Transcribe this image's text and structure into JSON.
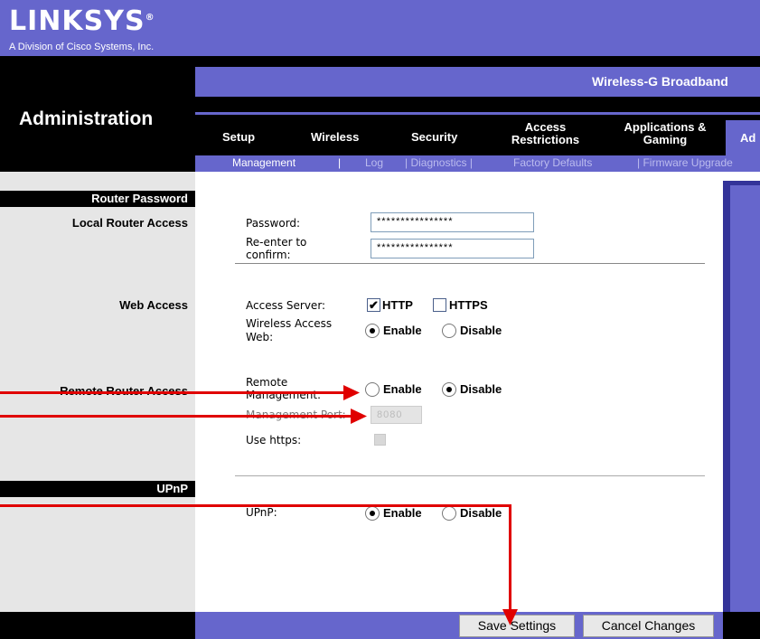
{
  "brand": {
    "logo": "LINKSYS",
    "registered": "®",
    "tagline": "A Division of Cisco Systems, Inc."
  },
  "product_title": "Wireless-G Broadband",
  "page_title": "Administration",
  "tabs": [
    {
      "label": "Setup"
    },
    {
      "label": "Wireless"
    },
    {
      "label": "Security"
    },
    {
      "label": "Access Restrictions"
    },
    {
      "label": "Applications & Gaming"
    },
    {
      "label": "Ad"
    }
  ],
  "subtabs": [
    {
      "label": "Management"
    },
    {
      "label": "|"
    },
    {
      "label": "Log"
    },
    {
      "label": "|  Diagnostics  |"
    },
    {
      "label": "Factory Defaults"
    },
    {
      "label": "|  Firmware Upgrade"
    }
  ],
  "sections": {
    "router_password": "Router Password",
    "local_router_access": "Local Router Access",
    "web_access": "Web Access",
    "remote_router_access": "Remote Router Access",
    "upnp": "UPnP"
  },
  "form": {
    "password_label": "Password:",
    "password_value": "****************",
    "reenter_label_1": "Re-enter to",
    "reenter_label_2": "confirm:",
    "reenter_value": "****************",
    "access_server_label": "Access Server:",
    "http_label": "HTTP",
    "https_label": "HTTPS",
    "wireless_access_label_1": "Wireless Access",
    "wireless_access_label_2": "Web:",
    "enable_label": "Enable",
    "disable_label": "Disable",
    "remote_mgmt_label_1": "Remote",
    "remote_mgmt_label_2": "Management:",
    "mgmt_port_label": "Management Port:",
    "mgmt_port_value": "8080",
    "use_https_label": "Use https:",
    "upnp_label": "UPnP:"
  },
  "buttons": {
    "save": "Save Settings",
    "cancel": "Cancel Changes"
  },
  "colors": {
    "purple_bar": "#6666cc",
    "black_bar": "#000000",
    "arrow": "#e00000"
  }
}
